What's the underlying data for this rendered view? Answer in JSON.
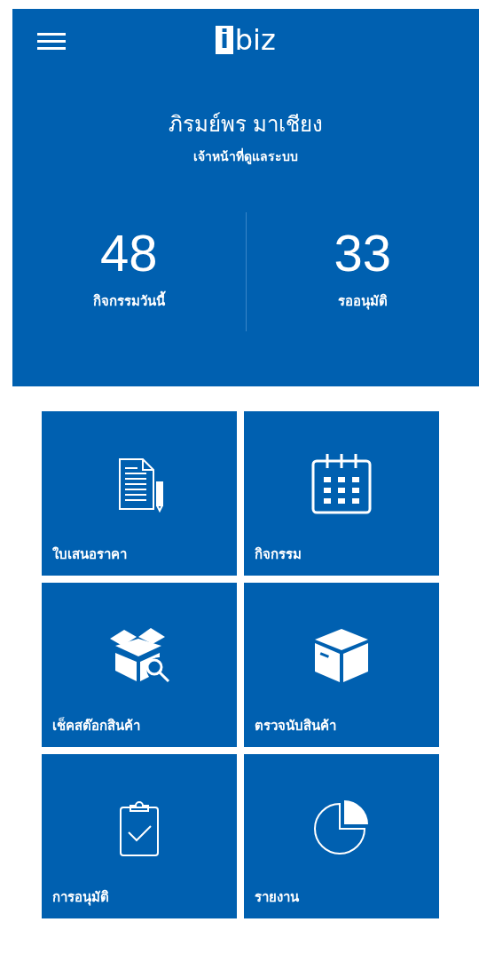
{
  "header": {
    "logo_mark": "i",
    "logo_text": "biz"
  },
  "profile": {
    "name": "ภิรมย์พร มาเชียง",
    "role": "เจ้าหน้าที่ดูแลระบบ"
  },
  "stats": [
    {
      "value": "48",
      "label": "กิจกรรมวันนี้"
    },
    {
      "value": "33",
      "label": "รออนุมัติ"
    }
  ],
  "tiles": [
    {
      "label": "ใบเสนอราคา",
      "kind": "document"
    },
    {
      "label": "กิจกรรม",
      "kind": "calendar"
    },
    {
      "label": "เช็คสต๊อกสินค้า",
      "kind": "box-search"
    },
    {
      "label": "ตรวจนับสินค้า",
      "kind": "box"
    },
    {
      "label": "การอนุมัติ",
      "kind": "clipboard"
    },
    {
      "label": "รายงาน",
      "kind": "pie"
    }
  ]
}
